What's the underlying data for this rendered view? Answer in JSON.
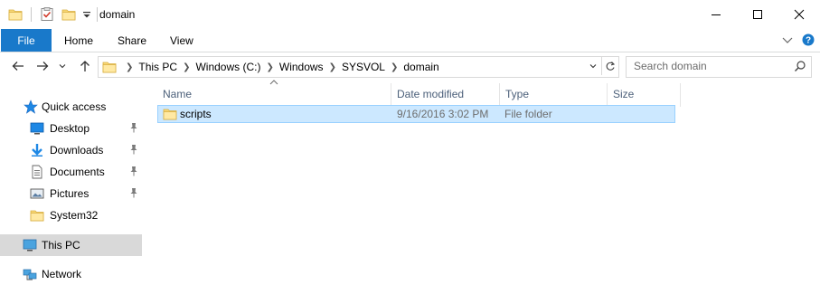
{
  "window": {
    "title": "domain",
    "controls": {
      "minimize_icon": "minimize-icon",
      "maximize_icon": "maximize-icon",
      "close_icon": "close-icon"
    }
  },
  "quick_access_toolbar": {
    "icons": [
      "folder-icon",
      "properties-icon",
      "new-folder-icon",
      "customize-qat-icon"
    ]
  },
  "ribbon": {
    "tabs": [
      {
        "label": "File"
      },
      {
        "label": "Home"
      },
      {
        "label": "Share"
      },
      {
        "label": "View"
      }
    ],
    "right_icons": [
      "expand-ribbon-icon",
      "help-icon"
    ]
  },
  "address_bar": {
    "breadcrumbs": [
      {
        "label": "This PC"
      },
      {
        "label": "Windows (C:)"
      },
      {
        "label": "Windows"
      },
      {
        "label": "SYSVOL"
      },
      {
        "label": "domain"
      }
    ]
  },
  "search": {
    "placeholder": "Search domain"
  },
  "navigation_pane": {
    "items": [
      {
        "label": "Quick access",
        "icon": "star-icon",
        "pinned": false
      },
      {
        "label": "Desktop",
        "icon": "desktop-icon",
        "pinned": true
      },
      {
        "label": "Downloads",
        "icon": "downloads-icon",
        "pinned": true
      },
      {
        "label": "Documents",
        "icon": "documents-icon",
        "pinned": true
      },
      {
        "label": "Pictures",
        "icon": "pictures-icon",
        "pinned": true
      },
      {
        "label": "System32",
        "icon": "folder-icon",
        "pinned": false
      },
      {
        "label": "This PC",
        "icon": "this-pc-icon",
        "pinned": false,
        "selected": true
      },
      {
        "label": "Network",
        "icon": "network-icon",
        "pinned": false
      }
    ]
  },
  "file_list": {
    "columns": [
      "Name",
      "Date modified",
      "Type",
      "Size"
    ],
    "sort_column": "Name",
    "rows": [
      {
        "name": "scripts",
        "date_modified": "9/16/2016 3:02 PM",
        "type": "File folder",
        "size": "",
        "selected": true
      }
    ]
  },
  "colors": {
    "accent": "#1979ca",
    "selection_bg": "#cce8ff",
    "selection_border": "#99d1ff",
    "nav_selected_bg": "#d9d9d9",
    "folder_yellow": "#f8d775"
  }
}
